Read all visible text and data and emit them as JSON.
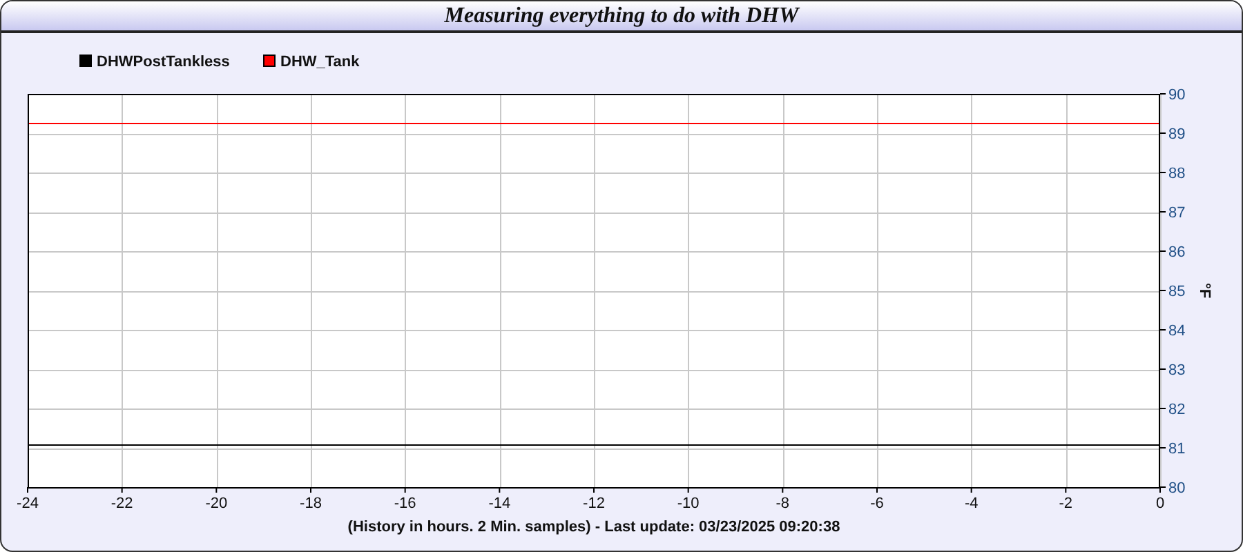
{
  "window": {
    "title": "Measuring everything to do with DHW"
  },
  "chart": {
    "chart_data": {
      "type": "line",
      "xlabel": "(History in hours. 2 Min. samples) - Last update: 03/23/2025 09:20:38",
      "ylabel": "°F",
      "x": [
        -24,
        0
      ],
      "series": [
        {
          "name": "DHWPostTankless",
          "color": "#000000",
          "values": [
            81.1,
            81.1
          ]
        },
        {
          "name": "DHW_Tank",
          "color": "#ff0000",
          "values": [
            89.25,
            89.25
          ]
        }
      ],
      "xlim": [
        -24,
        0
      ],
      "ylim": [
        80,
        90
      ],
      "xticks": [
        -24,
        -22,
        -20,
        -18,
        -16,
        -14,
        -12,
        -10,
        -8,
        -6,
        -4,
        -2,
        0
      ],
      "yticks": [
        80,
        81,
        82,
        83,
        84,
        85,
        86,
        87,
        88,
        89,
        90
      ],
      "grid": true,
      "legend": true
    }
  }
}
